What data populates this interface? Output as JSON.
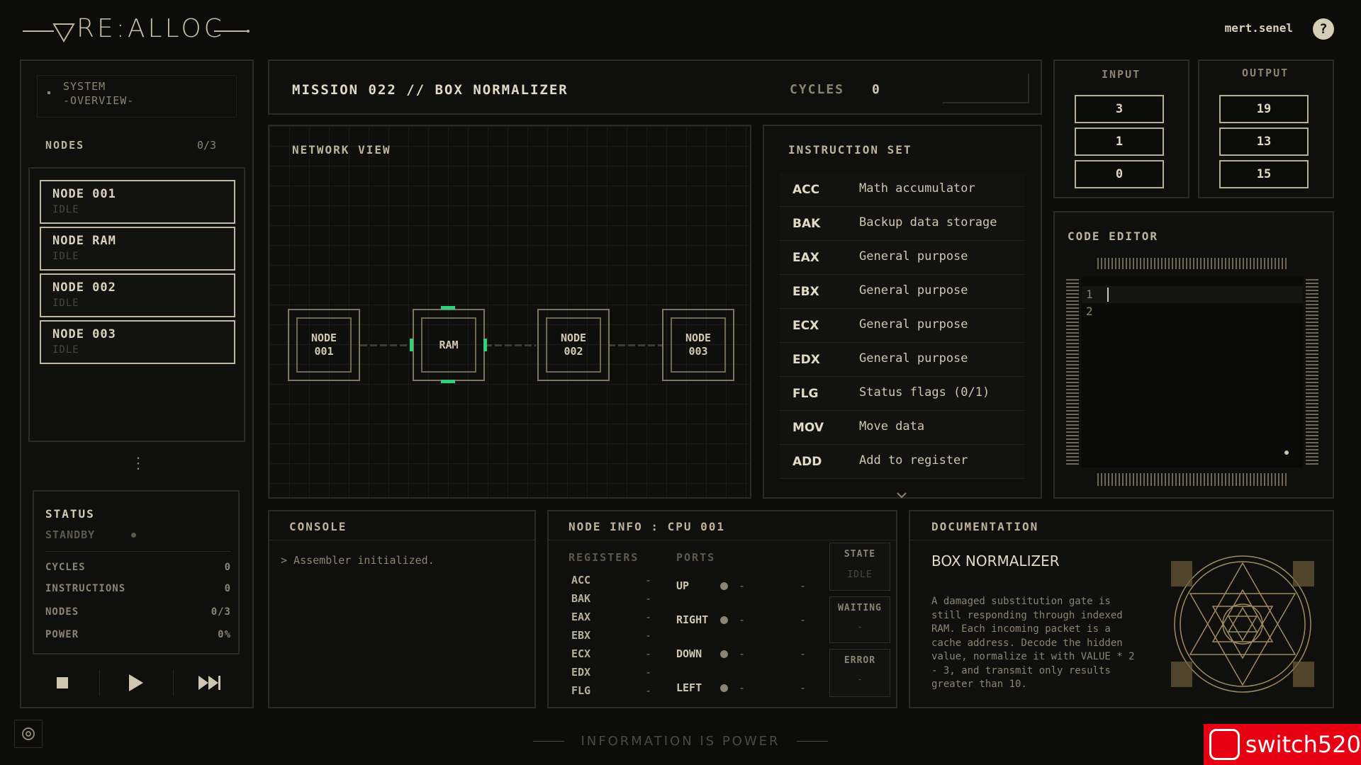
{
  "app": {
    "title": "RE:ALLOC",
    "user": "mert.senel",
    "help": "?"
  },
  "sidebar": {
    "overview_line1": "SYSTEM",
    "overview_line2": "-OVERVIEW-",
    "nodes_label": "NODES",
    "nodes_count": "0/3",
    "nodes": [
      {
        "name": "NODE 001",
        "state": "IDLE"
      },
      {
        "name": "NODE RAM",
        "state": "IDLE"
      },
      {
        "name": "NODE 002",
        "state": "IDLE"
      },
      {
        "name": "NODE 003",
        "state": "IDLE"
      }
    ],
    "more": "⋮",
    "status": {
      "title": "STATUS",
      "state": "STANDBY",
      "rows": [
        {
          "label": "CYCLES",
          "value": "0"
        },
        {
          "label": "INSTRUCTIONS",
          "value": "0"
        },
        {
          "label": "NODES",
          "value": "0/3"
        },
        {
          "label": "POWER",
          "value": "0%"
        }
      ]
    }
  },
  "mission": {
    "title": "MISSION 022 // BOX NORMALIZER",
    "cycles_label": "CYCLES",
    "cycles_value": "0"
  },
  "network": {
    "title": "NETWORK VIEW",
    "nodes": [
      {
        "line1": "NODE",
        "line2": "001"
      },
      {
        "line1": "RAM",
        "line2": ""
      },
      {
        "line1": "NODE",
        "line2": "002"
      },
      {
        "line1": "NODE",
        "line2": "003"
      }
    ]
  },
  "instructions": {
    "title": "INSTRUCTION SET",
    "items": [
      {
        "code": "ACC",
        "desc": "Math accumulator"
      },
      {
        "code": "BAK",
        "desc": "Backup data storage"
      },
      {
        "code": "EAX",
        "desc": "General purpose"
      },
      {
        "code": "EBX",
        "desc": "General purpose"
      },
      {
        "code": "ECX",
        "desc": "General purpose"
      },
      {
        "code": "EDX",
        "desc": "General purpose"
      },
      {
        "code": "FLG",
        "desc": "Status flags (0/1)"
      },
      {
        "code": "MOV",
        "desc": "Move data"
      },
      {
        "code": "ADD",
        "desc": "Add to register"
      }
    ]
  },
  "io": {
    "input_label": "INPUT",
    "input_values": [
      "3",
      "1",
      "0"
    ],
    "output_label": "OUTPUT",
    "output_values": [
      "19",
      "13",
      "15"
    ]
  },
  "editor": {
    "title": "CODE EDITOR",
    "lines": [
      "1",
      "2"
    ]
  },
  "console": {
    "title": "CONSOLE",
    "log": "> Assembler initialized."
  },
  "node_info": {
    "title": "NODE INFO : CPU 001",
    "registers_label": "REGISTERS",
    "ports_label": "PORTS",
    "registers": [
      {
        "name": "ACC",
        "value": "-"
      },
      {
        "name": "BAK",
        "value": "-"
      },
      {
        "name": "EAX",
        "value": "-"
      },
      {
        "name": "EBX",
        "value": "-"
      },
      {
        "name": "ECX",
        "value": "-"
      },
      {
        "name": "EDX",
        "value": "-"
      },
      {
        "name": "FLG",
        "value": "-"
      }
    ],
    "ports": [
      {
        "name": "UP",
        "v1": "-",
        "v2": "-"
      },
      {
        "name": "RIGHT",
        "v1": "-",
        "v2": "-"
      },
      {
        "name": "DOWN",
        "v1": "-",
        "v2": "-"
      },
      {
        "name": "LEFT",
        "v1": "-",
        "v2": "-"
      }
    ],
    "state_label": "STATE",
    "state_value": "IDLE",
    "waiting_label": "WAITING",
    "waiting_value": "-",
    "error_label": "ERROR",
    "error_value": "-"
  },
  "docs": {
    "title": "DOCUMENTATION",
    "heading": "BOX NORMALIZER",
    "body": "A damaged substitution gate is still responding through indexed RAM. Each incoming packet is a cache address. Decode the hidden value, normalize it with VALUE * 2 - 3, and transmit only results greater than 10."
  },
  "footer": {
    "tagline": "INFORMATION IS POWER"
  },
  "watermark": {
    "text": "switch520"
  },
  "colors": {
    "accent_green": "#2fd27a",
    "frame": "#bfb79f",
    "background": "#0c0c0a"
  }
}
